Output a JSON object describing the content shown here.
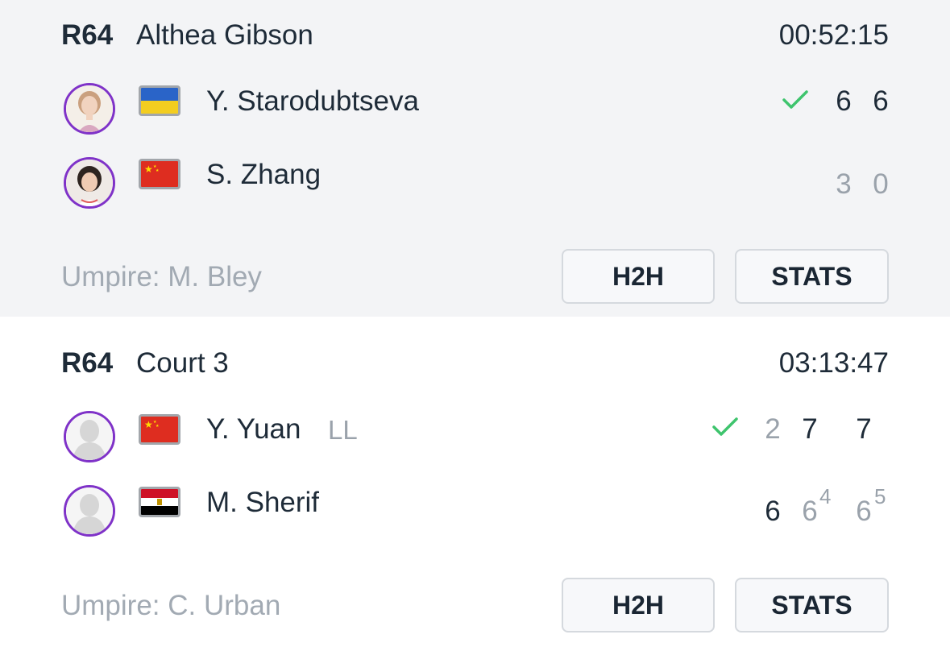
{
  "matches": [
    {
      "round": "R64",
      "court": "Althea Gibson",
      "duration": "00:52:15",
      "players": [
        {
          "name": "Y. Starodubtseva",
          "tag": "",
          "flag": "ukraine-flag",
          "photo": "player-photo",
          "winner": true,
          "sets": [
            "6",
            "6"
          ]
        },
        {
          "name": "S. Zhang",
          "tag": "",
          "flag": "china-flag",
          "photo": "player-photo",
          "winner": false,
          "sets": [
            "3",
            "0"
          ]
        }
      ],
      "umpire": "Umpire: M. Bley",
      "buttons": {
        "h2h": "H2H",
        "stats": "STATS"
      }
    },
    {
      "round": "R64",
      "court": "Court 3",
      "duration": "03:13:47",
      "players": [
        {
          "name": "Y. Yuan",
          "tag": "LL",
          "flag": "china-flag",
          "photo": "placeholder-silhouette",
          "winner": true,
          "sets": [
            "2",
            "7",
            "7"
          ]
        },
        {
          "name": "M. Sherif",
          "tag": "",
          "flag": "egypt-flag",
          "photo": "placeholder-silhouette",
          "winner": false,
          "sets": [
            "6",
            "6",
            "6"
          ],
          "tiebreaks": [
            "",
            "4",
            "5"
          ]
        }
      ],
      "umpire": "Umpire: C. Urban",
      "buttons": {
        "h2h": "H2H",
        "stats": "STATS"
      }
    }
  ],
  "colors": {
    "accent_purple": "#7f32c8",
    "check_green": "#3ec46d",
    "muted_grey": "#9aa2ab",
    "dark_text": "#1e2b38"
  }
}
